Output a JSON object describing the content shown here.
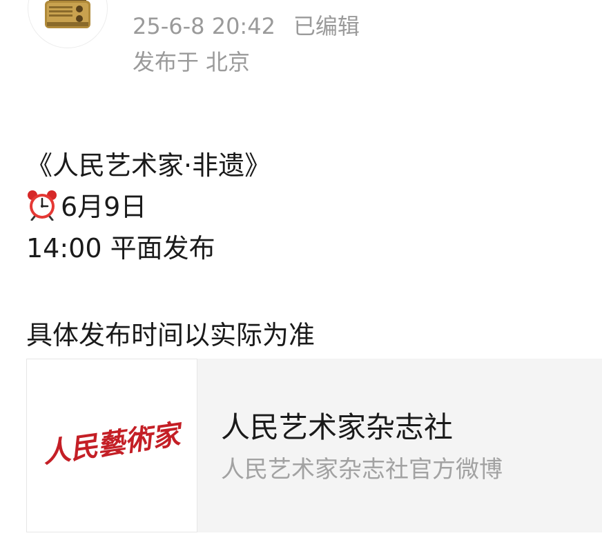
{
  "header": {
    "timestamp": "25-6-8 20:42",
    "edited_label": "已编辑",
    "published_prefix": "发布于",
    "location": "北京"
  },
  "post": {
    "line1": "《人民艺术家·非遗》",
    "date_text": "6月9日",
    "line3": "14:00 平面发布",
    "line4": "具体发布时间以实际为准",
    "alarm_icon": "alarm-clock-emoji"
  },
  "card": {
    "logo_text": "人民藝術家",
    "title": "人民艺术家杂志社",
    "subtitle": "人民艺术家杂志社官方微博"
  },
  "colors": {
    "meta_gray": "#9a9a9a",
    "text_dark": "#1a1a1a",
    "card_bg": "#f4f4f4",
    "logo_red": "#c41f26",
    "radio_gold": "#b08a3a"
  }
}
